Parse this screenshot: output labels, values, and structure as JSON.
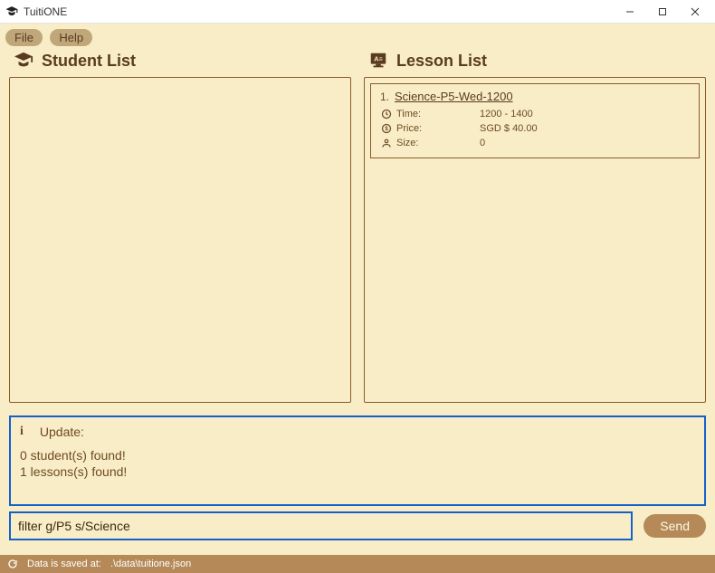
{
  "window": {
    "title": "TuitiONE"
  },
  "menu": {
    "file": "File",
    "help": "Help"
  },
  "columns": {
    "students": {
      "heading": "Student List"
    },
    "lessons": {
      "heading": "Lesson List",
      "items": [
        {
          "index": "1.",
          "name": "Science-P5-Wed-1200",
          "time_label": "Time:",
          "time_value": "1200 - 1400",
          "price_label": "Price:",
          "price_value": "SGD $ 40.00",
          "size_label": "Size:",
          "size_value": "0"
        }
      ]
    }
  },
  "update": {
    "heading": "Update:",
    "lines": [
      "0 student(s) found!",
      "1 lessons(s) found!"
    ]
  },
  "command": {
    "value": "filter g/P5 s/Science",
    "send_label": "Send"
  },
  "status": {
    "label": "Data is saved at:",
    "path": ".\\data\\tuitione.json"
  }
}
